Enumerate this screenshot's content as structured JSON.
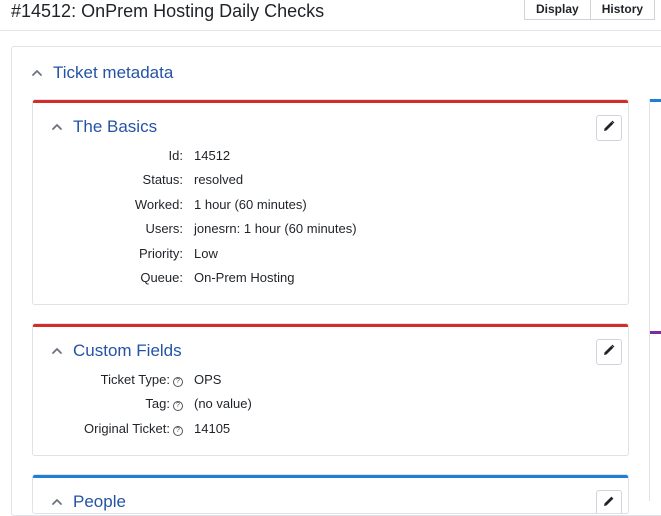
{
  "header": {
    "title": "#14512: OnPrem Hosting Daily Checks",
    "tabs": [
      "Display",
      "History"
    ]
  },
  "section": {
    "title": "Ticket metadata"
  },
  "basics": {
    "title": "The Basics",
    "accent": "#d62b2b",
    "fields": [
      {
        "label": "Id:",
        "value": "14512"
      },
      {
        "label": "Status:",
        "value": "resolved"
      },
      {
        "label": "Worked:",
        "value": "1 hour (60 minutes)"
      },
      {
        "label": "Users:",
        "value": "jonesrn: 1 hour (60 minutes)"
      },
      {
        "label": "Priority:",
        "value": "Low"
      },
      {
        "label": "Queue:",
        "value": "On-Prem Hosting"
      }
    ]
  },
  "custom_fields": {
    "title": "Custom Fields",
    "accent": "#d62b2b",
    "fields": [
      {
        "label": "Ticket Type:",
        "value": "OPS"
      },
      {
        "label": "Tag:",
        "value": "(no value)"
      },
      {
        "label": "Original Ticket:",
        "value": "14105"
      }
    ]
  },
  "third_card": {
    "title": "People",
    "accent": "#1e7fd6"
  },
  "colors": {
    "link_blue": "#2453a6",
    "red_accent": "#d62b2b",
    "blue_accent": "#1e7fd6",
    "purple_accent": "#7b2d9c"
  }
}
